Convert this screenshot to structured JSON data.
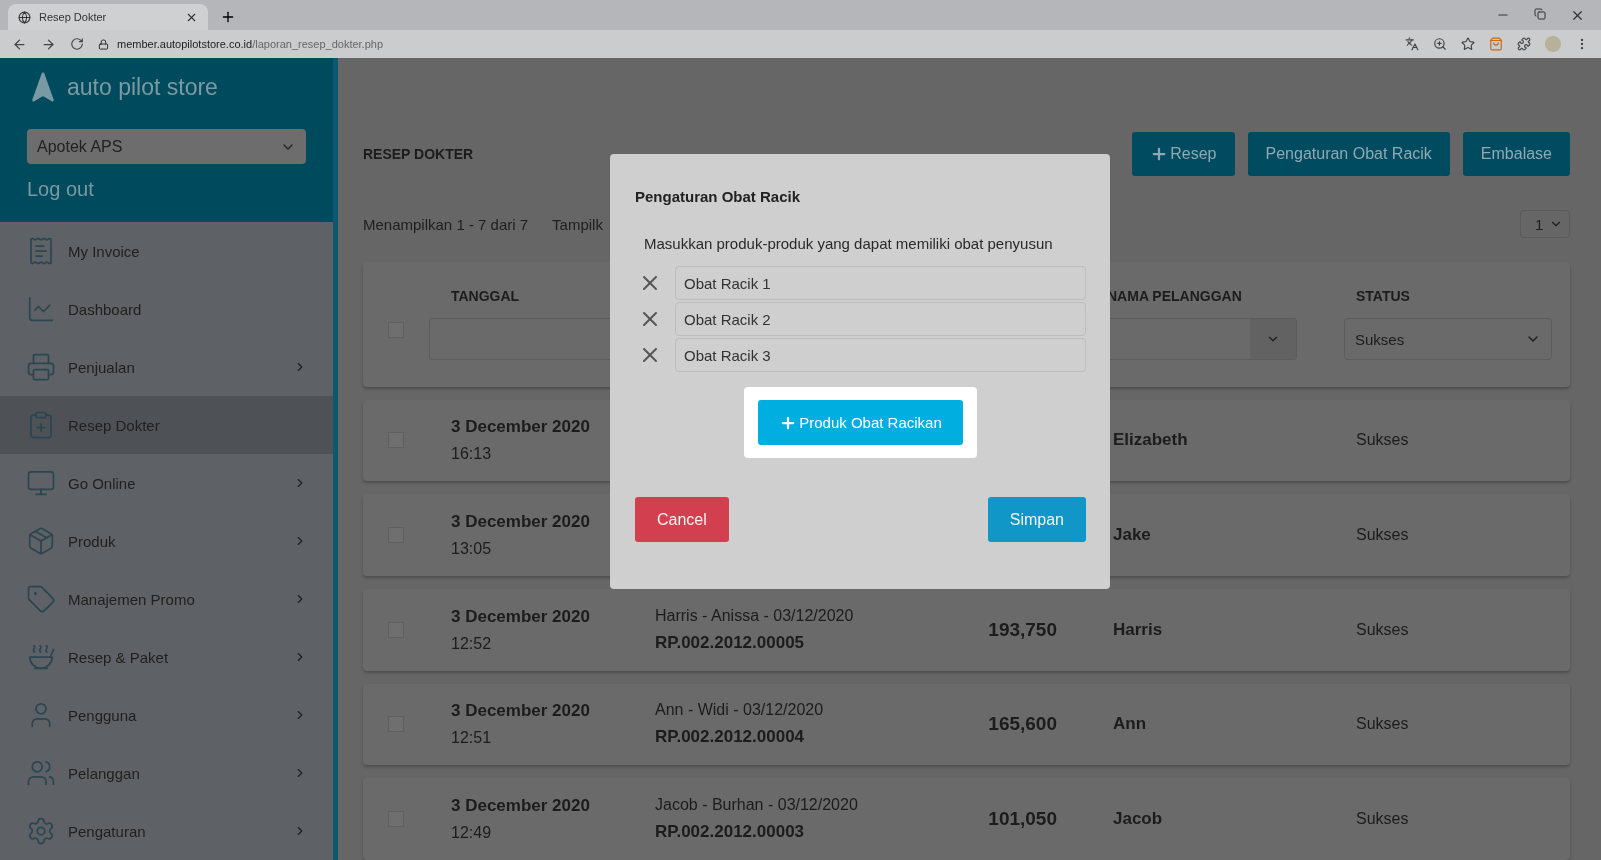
{
  "browser": {
    "tab_title": "Resep Dokter",
    "url_host": "member.autopilotstore.co.id",
    "url_path": "/laporan_resep_dokter.php"
  },
  "sidebar": {
    "brand": "auto pilot store",
    "store_select": "Apotek APS",
    "logout": "Log out",
    "items": [
      {
        "label": "My Invoice",
        "selected": false,
        "expandable": false
      },
      {
        "label": "Dashboard",
        "selected": false,
        "expandable": false
      },
      {
        "label": "Penjualan",
        "selected": false,
        "expandable": true
      },
      {
        "label": "Resep Dokter",
        "selected": true,
        "expandable": false
      },
      {
        "label": "Go Online",
        "selected": false,
        "expandable": true
      },
      {
        "label": "Produk",
        "selected": false,
        "expandable": true
      },
      {
        "label": "Manajemen Promo",
        "selected": false,
        "expandable": true
      },
      {
        "label": "Resep & Paket",
        "selected": false,
        "expandable": true
      },
      {
        "label": "Pengguna",
        "selected": false,
        "expandable": true
      },
      {
        "label": "Pelanggan",
        "selected": false,
        "expandable": true
      },
      {
        "label": "Pengaturan",
        "selected": false,
        "expandable": true
      }
    ]
  },
  "page": {
    "title": "RESEP DOKTER",
    "actions": [
      {
        "label": "Resep",
        "kind": "add"
      },
      {
        "label": "Pengaturan Obat Racik",
        "kind": "plain"
      },
      {
        "label": "Embalase",
        "kind": "plain"
      }
    ],
    "summary": "Menampilkan 1 - 7 dari 7",
    "show_label": "Tampilk",
    "page_select": "1"
  },
  "table": {
    "header_checked": false,
    "columns": {
      "date": "TANGGAL",
      "name": "NAMA PELANGGAN",
      "status": "STATUS"
    },
    "status_filter": "Sukses",
    "rows": [
      {
        "checked": false,
        "date": "3 December 2020",
        "time": "16:13",
        "name": "Elizabeth",
        "status": "Sukses"
      },
      {
        "checked": false,
        "date": "3 December 2020",
        "time": "13:05",
        "name": "Jake",
        "status": "Sukses"
      },
      {
        "checked": false,
        "date": "3 December 2020",
        "time": "12:52",
        "description": "Harris - Anissa - 03/12/2020",
        "code": "RP.002.2012.00005",
        "total": "193,750",
        "name": "Harris",
        "status": "Sukses"
      },
      {
        "checked": false,
        "date": "3 December 2020",
        "time": "12:51",
        "description": "Ann - Widi - 03/12/2020",
        "code": "RP.002.2012.00004",
        "total": "165,600",
        "name": "Ann",
        "status": "Sukses"
      },
      {
        "checked": false,
        "date": "3 December 2020",
        "time": "12:49",
        "description": "Jacob - Burhan - 03/12/2020",
        "code": "RP.002.2012.00003",
        "total": "101,050",
        "name": "Jacob",
        "status": "Sukses"
      }
    ]
  },
  "modal": {
    "title": "Pengaturan Obat Racik",
    "description": "Masukkan produk-produk yang dapat memiliki obat penyusun",
    "items": [
      "Obat Racik 1",
      "Obat Racik 2",
      "Obat Racik 3"
    ],
    "add_button": "Produk Obat Racikan",
    "cancel": "Cancel",
    "save": "Simpan"
  }
}
